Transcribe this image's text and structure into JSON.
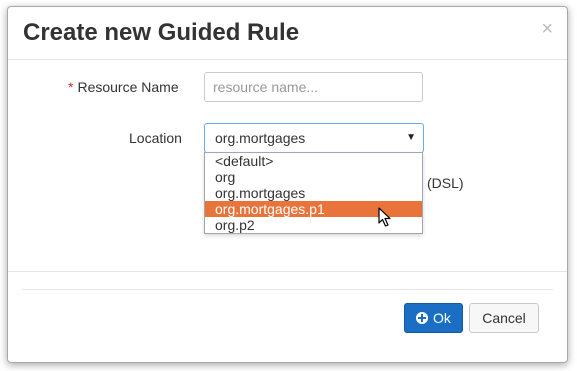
{
  "dialog": {
    "title": "Create new Guided Rule",
    "close_label": "×"
  },
  "form": {
    "resource_name": {
      "required_marker": "*",
      "label": "Resource Name",
      "placeholder": "resource name..."
    },
    "location": {
      "label": "Location",
      "selected": "org.mortgages",
      "options": [
        "<default>",
        "org",
        "org.mortgages",
        "org.mortgages.p1",
        "org.p2"
      ],
      "highlighted_option": "org.mortgages.p1"
    },
    "partially_hidden_text": "(DSL)"
  },
  "footer": {
    "ok_label": "Ok",
    "cancel_label": "Cancel"
  },
  "colors": {
    "primary": "#1a6fc4",
    "highlight": "#e8743b",
    "required": "#c9302c"
  }
}
